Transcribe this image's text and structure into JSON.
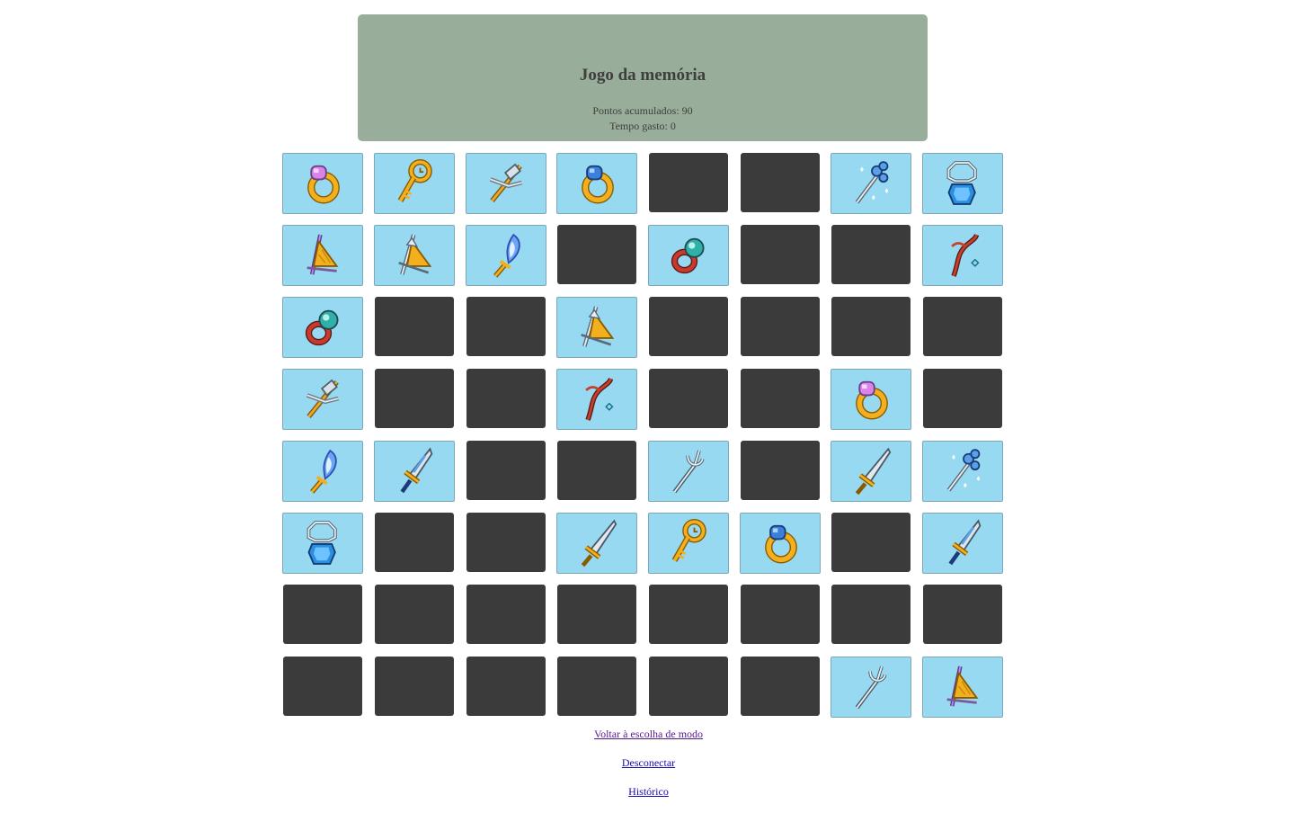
{
  "header": {
    "title": "Jogo da memória",
    "points_label": "Pontos acumulados: 90",
    "time_label": "Tempo gasto: 0"
  },
  "board": {
    "rows": [
      [
        "ring-pink-icon",
        "key-icon",
        "crossbow-icon",
        "ring-blue-icon",
        null,
        null,
        "magic-trident-icon",
        "amulet-icon"
      ],
      [
        "fan-bow-icon",
        "crystal-bow-icon",
        "flame-dagger-icon",
        null,
        "ring-teal-icon",
        null,
        null,
        "fire-staff-icon"
      ],
      [
        "ring-teal-icon",
        null,
        null,
        "crystal-bow-icon",
        null,
        null,
        null,
        null
      ],
      [
        "crossbow-icon",
        null,
        null,
        "fire-staff-icon",
        null,
        null,
        "ring-pink-icon",
        null
      ],
      [
        "flame-dagger-icon",
        "crystal-sword-icon",
        null,
        null,
        "trident-icon",
        null,
        "steel-sword-icon",
        "magic-trident-icon"
      ],
      [
        "amulet-icon",
        null,
        null,
        "steel-sword-icon",
        "key-icon",
        "ring-blue-icon",
        null,
        "crystal-sword-icon"
      ],
      [
        null,
        null,
        null,
        null,
        null,
        null,
        null,
        null
      ],
      [
        null,
        null,
        null,
        null,
        null,
        null,
        "trident-icon",
        "fan-bow-icon"
      ]
    ]
  },
  "links": {
    "back": "Voltar à escolha de modo",
    "logout": "Desconectar",
    "history": "Histórico"
  },
  "colors": {
    "header_bg": "#99ae9a",
    "card_hidden": "#3b3b3b",
    "card_revealed": "#97d9f0"
  }
}
